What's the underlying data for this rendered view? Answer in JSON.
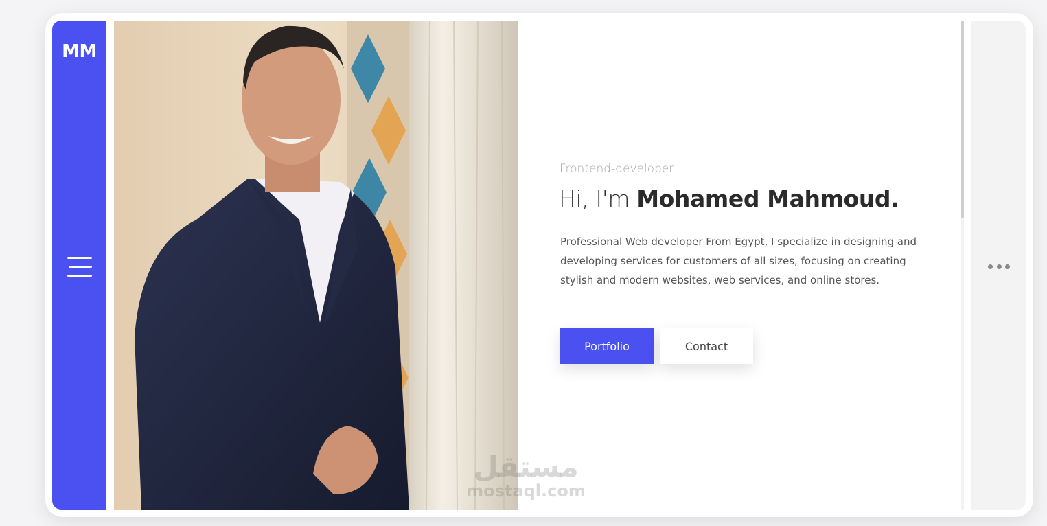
{
  "sidebar": {
    "logo": "MM",
    "menu_icon": "hamburger-menu-icon"
  },
  "hero": {
    "subtitle": "Frontend-developer",
    "greeting": "Hi, I'm",
    "name": "Mohamed Mahmoud.",
    "description": "Professional Web developer From Egypt, I specialize in designing and developing services for customers of all sizes, focusing on creating stylish and modern websites, web services, and online stores.",
    "photo_alt": "Portrait of Mohamed Mahmoud in a navy suit"
  },
  "buttons": {
    "primary_label": "Portfolio",
    "secondary_label": "Contact"
  },
  "right_panel": {
    "more_icon": "more-horizontal-icon"
  },
  "watermark": {
    "arabic": "مستقل",
    "latin": "mostaql.com"
  },
  "colors": {
    "accent": "#4a51f0",
    "text_dark": "#2b2b2b",
    "text_muted": "#a6a6a6",
    "panel_bg": "#f3f3f3"
  }
}
